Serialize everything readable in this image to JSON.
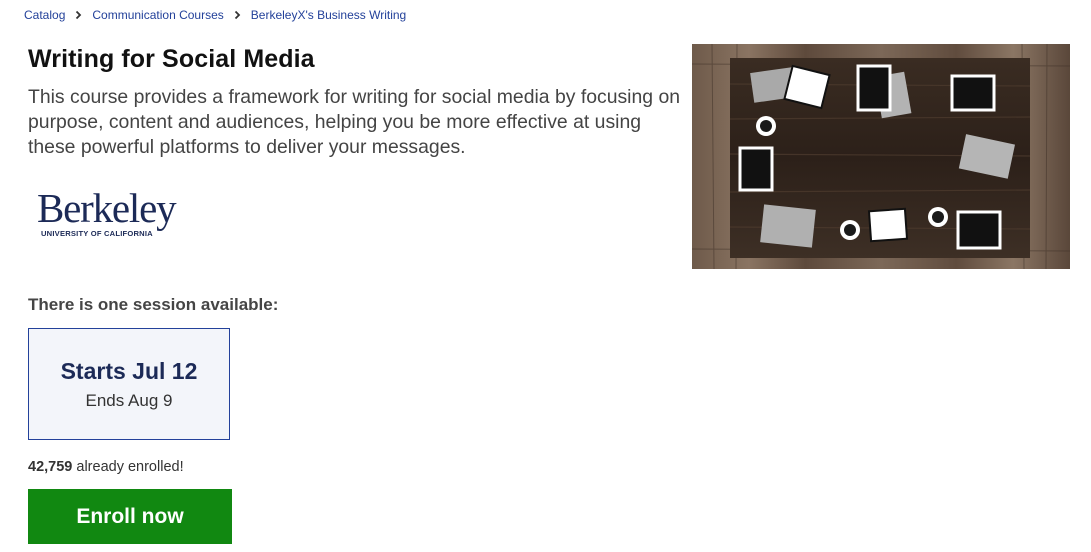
{
  "breadcrumb": {
    "items": [
      {
        "label": "Catalog"
      },
      {
        "label": "Communication Courses"
      },
      {
        "label": "BerkeleyX's Business Writing"
      }
    ]
  },
  "course": {
    "title": "Writing for Social Media",
    "description": "This course provides a framework for writing for social media by focusing on purpose, content and audiences, helping you be more effective at using these powerful platforms to deliver your messages."
  },
  "logo": {
    "name": "Berkeley",
    "subtitle": "UNIVERSITY OF CALIFORNIA",
    "color": "#1c2a57"
  },
  "sessions": {
    "heading": "There is one session available:",
    "items": [
      {
        "start": "Starts Jul 12",
        "end": "Ends Aug 9"
      }
    ]
  },
  "enrollment": {
    "count": "42,759",
    "suffix": " already enrolled!",
    "button_label": "Enroll now",
    "button_color": "#118811"
  },
  "icons": {
    "breadcrumb_separator": "chevron-right-icon"
  }
}
